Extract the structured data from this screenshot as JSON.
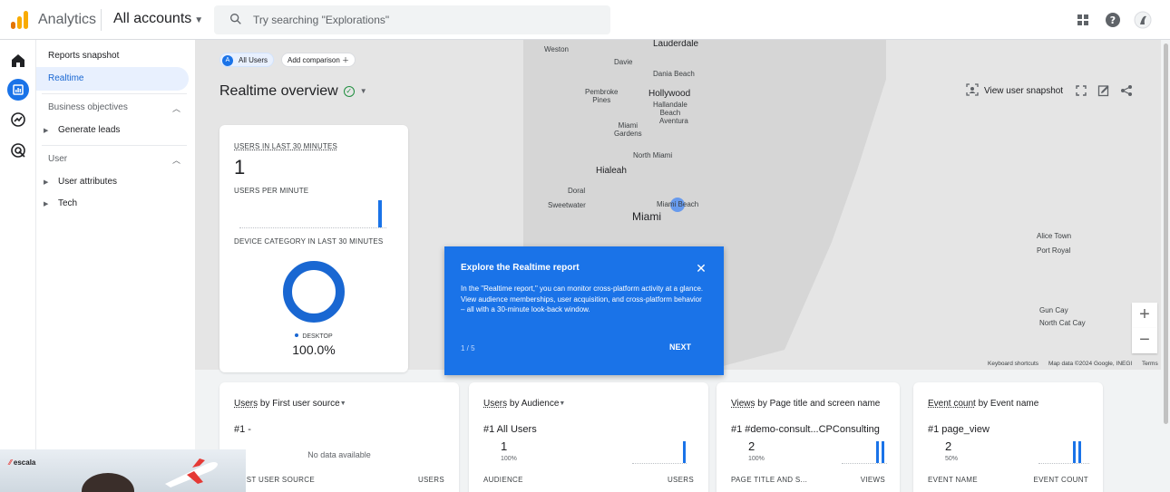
{
  "app": {
    "name": "Analytics",
    "account_selector": "All accounts"
  },
  "search": {
    "placeholder": "Try searching \"Explorations\""
  },
  "nav": {
    "reports_snapshot": "Reports snapshot",
    "realtime": "Realtime",
    "business_objectives": "Business objectives",
    "generate_leads": "Generate leads",
    "user": "User",
    "user_attributes": "User attributes",
    "tech": "Tech"
  },
  "filters": {
    "segment_badge": "A",
    "segment_label": "All Users",
    "add_comparison": "Add comparison"
  },
  "page": {
    "title": "Realtime overview"
  },
  "toolbar": {
    "view_user_snapshot": "View user snapshot"
  },
  "map": {
    "labels": [
      {
        "text": "Lauderdale",
        "cls": "med"
      },
      {
        "text": "Weston",
        "cls": ""
      },
      {
        "text": "Davie",
        "cls": ""
      },
      {
        "text": "Dania Beach",
        "cls": ""
      },
      {
        "text": "Pembroke\nPines",
        "cls": ""
      },
      {
        "text": "Hollywood",
        "cls": "med"
      },
      {
        "text": "Hallandale\nBeach",
        "cls": ""
      },
      {
        "text": "Aventura",
        "cls": ""
      },
      {
        "text": "Miami\nGardens",
        "cls": ""
      },
      {
        "text": "North Miami",
        "cls": ""
      },
      {
        "text": "Hialeah",
        "cls": "med"
      },
      {
        "text": "Doral",
        "cls": ""
      },
      {
        "text": "Sweetwater",
        "cls": ""
      },
      {
        "text": "Miami Beach",
        "cls": ""
      },
      {
        "text": "Miami",
        "cls": "big"
      },
      {
        "text": "Alice Town",
        "cls": ""
      },
      {
        "text": "Port Royal",
        "cls": ""
      },
      {
        "text": "Gun Cay",
        "cls": ""
      },
      {
        "text": "North Cat Cay",
        "cls": ""
      }
    ],
    "keyboard_shortcuts": "Keyboard shortcuts",
    "map_data": "Map data ©2024 Google, INEGI",
    "terms": "Terms",
    "zoom_in": "+",
    "zoom_out": "−"
  },
  "realtime_card": {
    "users_30_label": "USERS IN LAST 30 MINUTES",
    "users_30_value": "1",
    "users_per_minute_label": "USERS PER MINUTE",
    "users_per_minute_last": 1,
    "device_label": "DEVICE CATEGORY IN LAST 30 MINUTES",
    "device_name": "DESKTOP",
    "device_pct": "100.0%",
    "device_color": "#1967d2"
  },
  "tour": {
    "title": "Explore the Realtime report",
    "body": "In the \"Realtime report,\" you can monitor cross-platform activity at a glance. View audience memberships, user acquisition, and cross-platform behavior – all with a 30-minute look-back window.",
    "step": "1 / 5",
    "next": "NEXT",
    "close_glyph": "✕",
    "color": "#1a73e8"
  },
  "cards": [
    {
      "title_a": "Users",
      "title_b": " by First user source",
      "rank": "#1 -",
      "value": "",
      "pct": "",
      "nodata": "No data available",
      "col_left": "FIRST USER SOURCE",
      "col_right": "USERS"
    },
    {
      "title_a": "Users",
      "title_b": " by Audience",
      "rank": "#1  All Users",
      "value": "1",
      "pct": "100%",
      "nodata": "",
      "col_left": "AUDIENCE",
      "col_right": "USERS"
    },
    {
      "title_a": "Views",
      "title_b": " by Page title and screen name",
      "rank": "#1  #demo-consult...CPConsulting",
      "value": "2",
      "pct": "100%",
      "nodata": "",
      "col_left": "PAGE TITLE AND S...",
      "col_right": "VIEWS"
    },
    {
      "title_a": "Event count",
      "title_b": " by Event name",
      "rank": "#1  page_view",
      "value": "2",
      "pct": "50%",
      "nodata": "",
      "col_left": "EVENT NAME",
      "col_right": "EVENT COUNT"
    }
  ],
  "webcam": {
    "brand": "escala"
  },
  "colors": {
    "accent": "#1a73e8",
    "logo_orange": "#f9ab00",
    "logo_dark_orange": "#e37400"
  }
}
